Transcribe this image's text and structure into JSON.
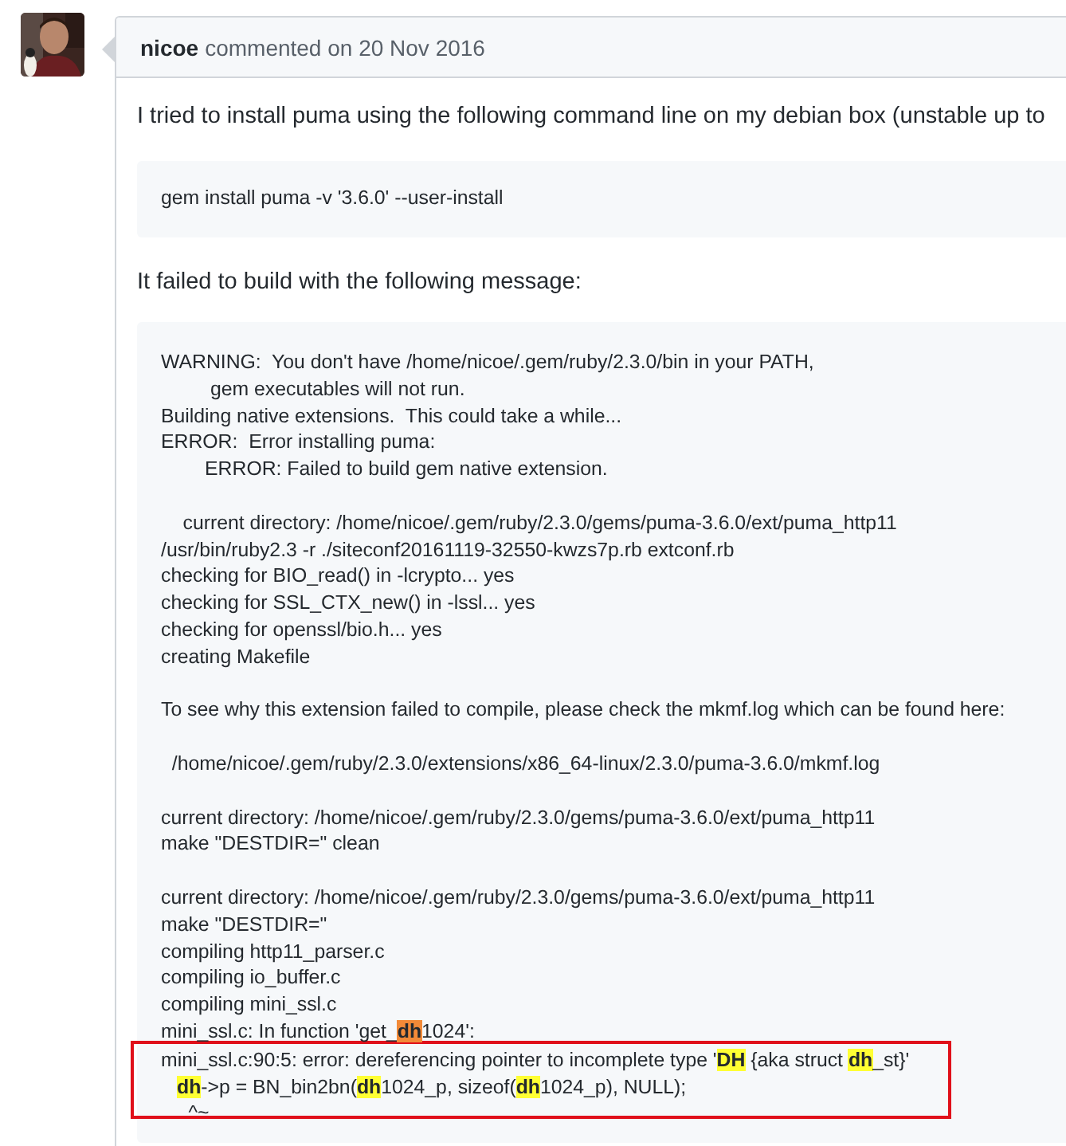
{
  "comment": {
    "author": "nicoe",
    "action": "commented on 20 Nov 2016",
    "intro": "I tried to install puma using the following command line on my debian box (unstable up to",
    "command": "gem install puma -v '3.6.0' --user-install",
    "lead": "It failed to build with the following message:",
    "log": [
      {
        "kind": "text",
        "boxed": false,
        "parts": [
          {
            "kind": "plain",
            "text": "WARNING:  You don't have /home/nicoe/.gem/ruby/2.3.0/bin in your PATH,"
          }
        ]
      },
      {
        "kind": "text",
        "boxed": false,
        "parts": [
          {
            "kind": "plain",
            "text": "         gem executables will not run."
          }
        ]
      },
      {
        "kind": "text",
        "boxed": false,
        "parts": [
          {
            "kind": "plain",
            "text": "Building native extensions.  This could take a while..."
          }
        ]
      },
      {
        "kind": "text",
        "boxed": false,
        "parts": [
          {
            "kind": "plain",
            "text": "ERROR:  Error installing puma:"
          }
        ]
      },
      {
        "kind": "text",
        "boxed": false,
        "parts": [
          {
            "kind": "plain",
            "text": "        ERROR: Failed to build gem native extension."
          }
        ]
      },
      {
        "kind": "blank",
        "boxed": false
      },
      {
        "kind": "text",
        "boxed": false,
        "parts": [
          {
            "kind": "plain",
            "text": "    current directory: /home/nicoe/.gem/ruby/2.3.0/gems/puma-3.6.0/ext/puma_http11"
          }
        ]
      },
      {
        "kind": "text",
        "boxed": false,
        "parts": [
          {
            "kind": "plain",
            "text": "/usr/bin/ruby2.3 -r ./siteconf20161119-32550-kwzs7p.rb extconf.rb"
          }
        ]
      },
      {
        "kind": "text",
        "boxed": false,
        "parts": [
          {
            "kind": "plain",
            "text": "checking for BIO_read() in -lcrypto... yes"
          }
        ]
      },
      {
        "kind": "text",
        "boxed": false,
        "parts": [
          {
            "kind": "plain",
            "text": "checking for SSL_CTX_new() in -lssl... yes"
          }
        ]
      },
      {
        "kind": "text",
        "boxed": false,
        "parts": [
          {
            "kind": "plain",
            "text": "checking for openssl/bio.h... yes"
          }
        ]
      },
      {
        "kind": "text",
        "boxed": false,
        "parts": [
          {
            "kind": "plain",
            "text": "creating Makefile"
          }
        ]
      },
      {
        "kind": "blank",
        "boxed": false
      },
      {
        "kind": "text",
        "boxed": false,
        "parts": [
          {
            "kind": "plain",
            "text": "To see why this extension failed to compile, please check the mkmf.log which can be found here:"
          }
        ]
      },
      {
        "kind": "blank",
        "boxed": false
      },
      {
        "kind": "text",
        "boxed": false,
        "parts": [
          {
            "kind": "plain",
            "text": "  /home/nicoe/.gem/ruby/2.3.0/extensions/x86_64-linux/2.3.0/puma-3.6.0/mkmf.log"
          }
        ]
      },
      {
        "kind": "blank",
        "boxed": false
      },
      {
        "kind": "text",
        "boxed": false,
        "parts": [
          {
            "kind": "plain",
            "text": "current directory: /home/nicoe/.gem/ruby/2.3.0/gems/puma-3.6.0/ext/puma_http11"
          }
        ]
      },
      {
        "kind": "text",
        "boxed": false,
        "parts": [
          {
            "kind": "plain",
            "text": "make \"DESTDIR=\" clean"
          }
        ]
      },
      {
        "kind": "blank",
        "boxed": false
      },
      {
        "kind": "text",
        "boxed": false,
        "parts": [
          {
            "kind": "plain",
            "text": "current directory: /home/nicoe/.gem/ruby/2.3.0/gems/puma-3.6.0/ext/puma_http11"
          }
        ]
      },
      {
        "kind": "text",
        "boxed": false,
        "parts": [
          {
            "kind": "plain",
            "text": "make \"DESTDIR=\""
          }
        ]
      },
      {
        "kind": "text",
        "boxed": false,
        "parts": [
          {
            "kind": "plain",
            "text": "compiling http11_parser.c"
          }
        ]
      },
      {
        "kind": "text",
        "boxed": false,
        "parts": [
          {
            "kind": "plain",
            "text": "compiling io_buffer.c"
          }
        ]
      },
      {
        "kind": "text",
        "boxed": false,
        "parts": [
          {
            "kind": "plain",
            "text": "compiling mini_ssl.c"
          }
        ]
      },
      {
        "kind": "text",
        "boxed": false,
        "parts": [
          {
            "kind": "plain",
            "text": "mini_ssl.c: In function 'get_"
          },
          {
            "kind": "current",
            "text": "dh"
          },
          {
            "kind": "plain",
            "text": "1024':"
          }
        ]
      },
      {
        "kind": "text",
        "boxed": true,
        "parts": [
          {
            "kind": "plain",
            "text": "mini_ssl.c:90:5: error: dereferencing pointer to incomplete type '"
          },
          {
            "kind": "match",
            "text": "DH"
          },
          {
            "kind": "plain",
            "text": " {aka struct "
          },
          {
            "kind": "match",
            "text": "dh"
          },
          {
            "kind": "plain",
            "text": "_st}'"
          }
        ]
      },
      {
        "kind": "text",
        "boxed": true,
        "indented": true,
        "parts": [
          {
            "kind": "match",
            "text": "dh"
          },
          {
            "kind": "plain",
            "text": "->p = BN_bin2bn("
          },
          {
            "kind": "match",
            "text": "dh"
          },
          {
            "kind": "plain",
            "text": "1024_p, sizeof("
          },
          {
            "kind": "match",
            "text": "dh"
          },
          {
            "kind": "plain",
            "text": "1024_p), NULL);"
          }
        ]
      },
      {
        "kind": "text",
        "boxed": true,
        "parts": [
          {
            "kind": "plain",
            "text": "     ^~"
          }
        ]
      }
    ]
  }
}
